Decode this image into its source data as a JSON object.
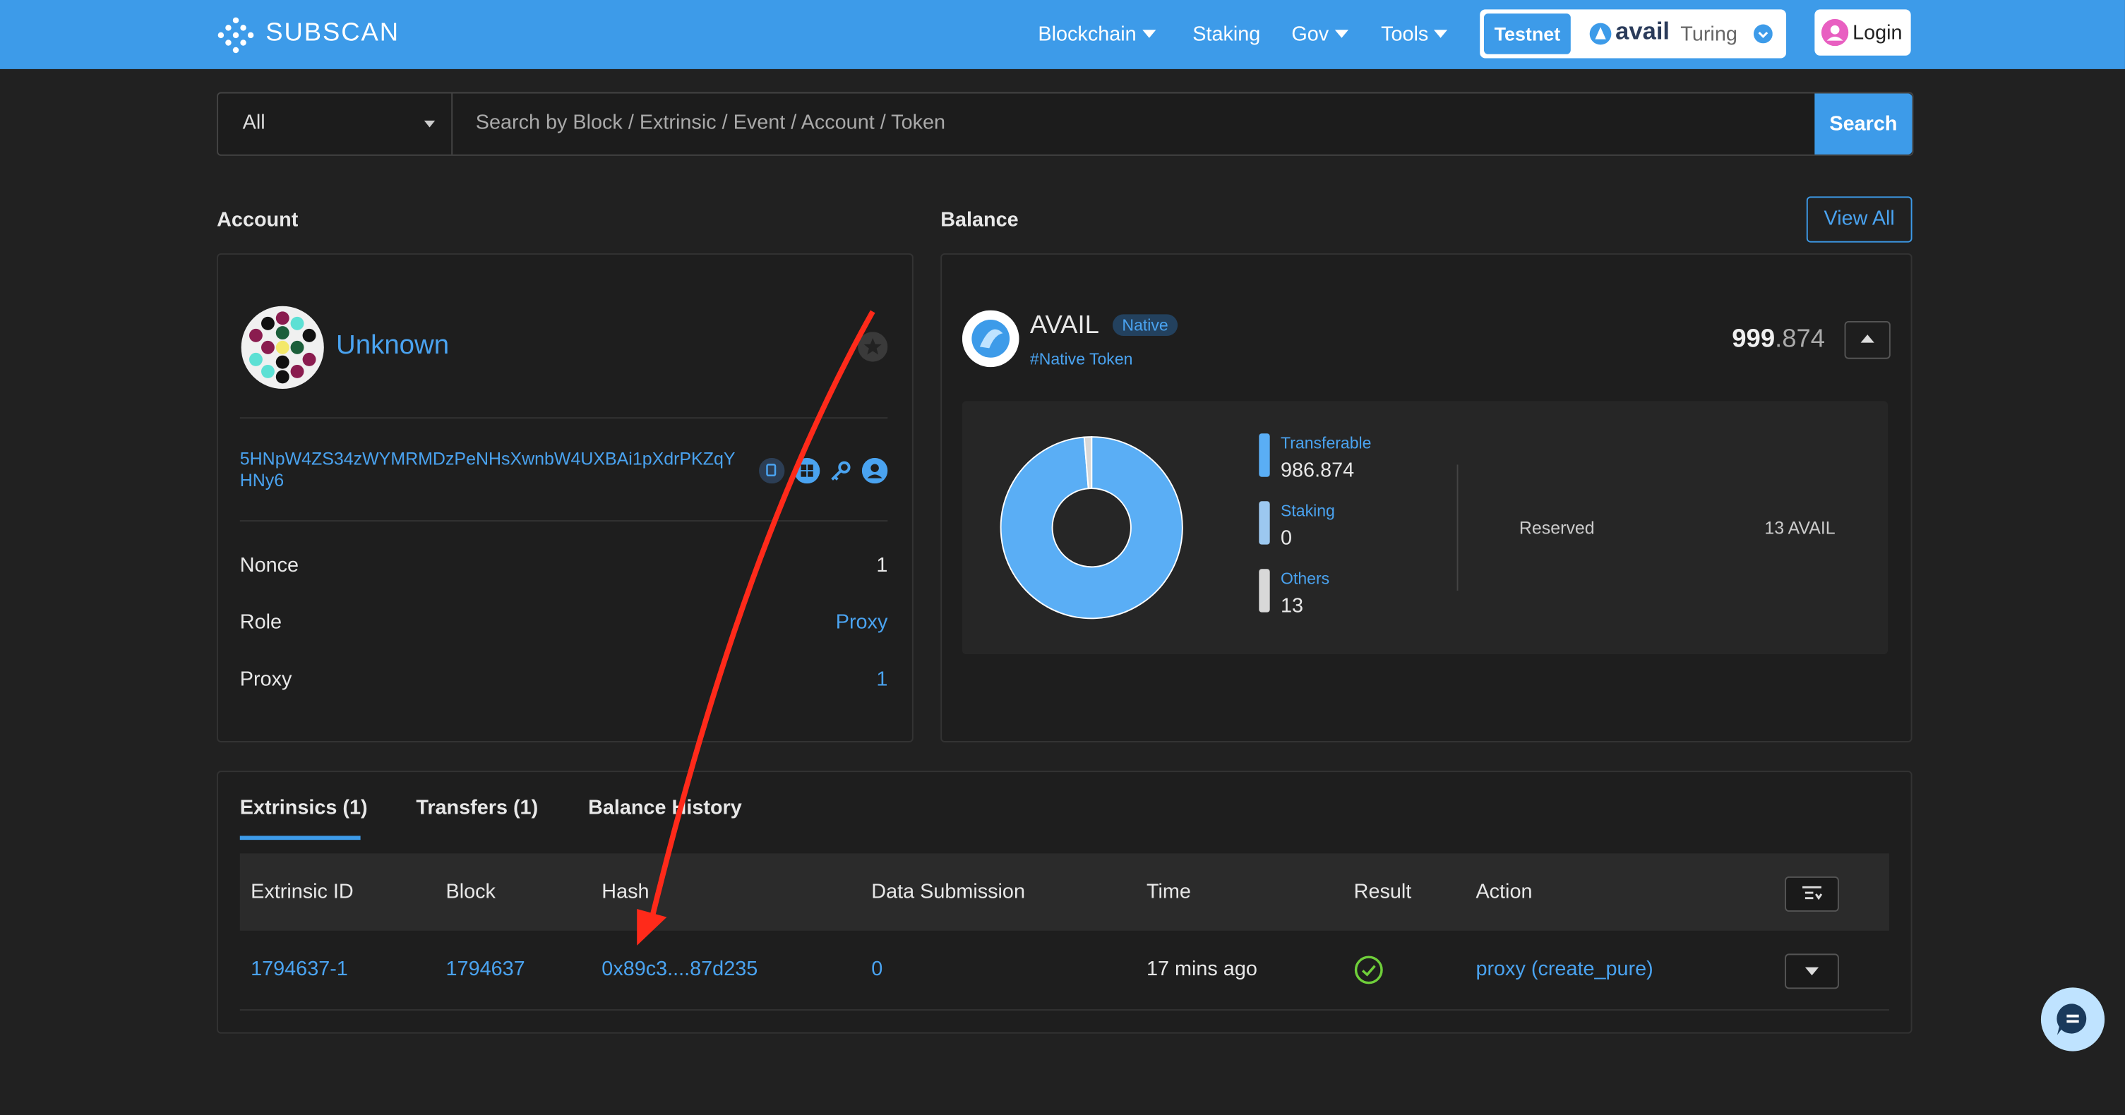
{
  "header": {
    "logo": "SUBSCAN",
    "nav": [
      "Blockchain",
      "Staking",
      "Gov",
      "Tools"
    ],
    "network_badge": "Testnet",
    "network_name": "avail",
    "network_suffix": "Turing",
    "login": "Login"
  },
  "search": {
    "select_value": "All",
    "placeholder": "Search by Block / Extrinsic / Event / Account / Token",
    "button": "Search"
  },
  "account": {
    "section_title": "Account",
    "name": "Unknown",
    "address_line1": "5HNpW4ZS34zWYMRMDzPeNHsXwnbW4UXBAi1pXdrPKZqY",
    "address_line2": "HNy6",
    "nonce_label": "Nonce",
    "nonce_value": "1",
    "role_label": "Role",
    "role_value": "Proxy",
    "proxy_label": "Proxy",
    "proxy_value": "1"
  },
  "balance": {
    "section_title": "Balance",
    "view_all": "View All",
    "token": "AVAIL",
    "badge": "Native",
    "tag": "#Native Token",
    "total_int": "999",
    "total_dec": ".874",
    "transferable_label": "Transferable",
    "transferable_value": "986.874",
    "staking_label": "Staking",
    "staking_value": "0",
    "others_label": "Others",
    "others_value": "13",
    "reserved_label": "Reserved",
    "reserved_value": "13 AVAIL",
    "donut": {
      "transferable": 986.874,
      "staking": 0,
      "others": 13
    },
    "colors": {
      "transferable": "#5aaef5",
      "staking": "#9cc8f0",
      "others": "#d8d8d8"
    }
  },
  "tabs": [
    "Extrinsics (1)",
    "Transfers (1)",
    "Balance History"
  ],
  "table": {
    "headers": [
      "Extrinsic ID",
      "Block",
      "Hash",
      "Data Submission",
      "Time",
      "Result",
      "Action"
    ],
    "rows": [
      {
        "id": "1794637-1",
        "block": "1794637",
        "hash": "0x89c3....87d235",
        "data_submission": "0",
        "time": "17 mins ago",
        "result": "success",
        "action": "proxy (create_pure)"
      }
    ]
  }
}
